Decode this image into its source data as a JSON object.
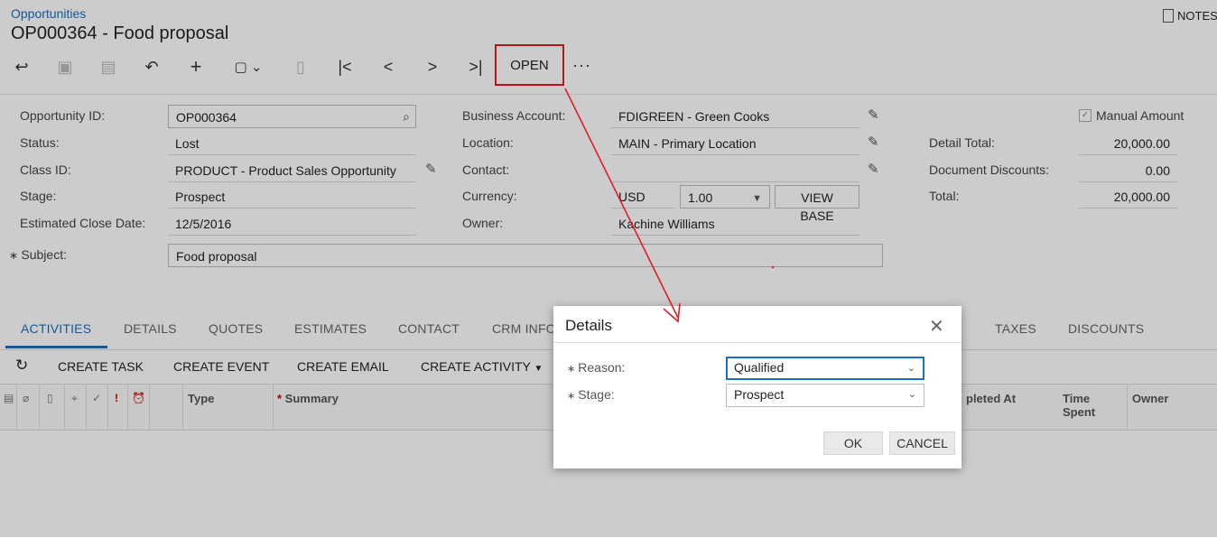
{
  "breadcrumb": "Opportunities",
  "title": "OP000364 - Food proposal",
  "notes_label": "NOTES",
  "toolbar": {
    "open_label": "OPEN",
    "more_label": "···",
    "icons": [
      "back-icon",
      "save-close-icon",
      "save-icon",
      "undo-icon",
      "add-icon",
      "copy-paste-icon",
      "delete-icon",
      "first-record-icon",
      "previous-record-icon",
      "next-record-icon",
      "last-record-icon"
    ]
  },
  "form": {
    "opportunity_id_label": "Opportunity ID:",
    "opportunity_id": "OP000364",
    "status_label": "Status:",
    "status": "Lost",
    "class_id_label": "Class ID:",
    "class_id": "PRODUCT - Product Sales Opportunity",
    "stage_label": "Stage:",
    "stage": "Prospect",
    "close_date_label": "Estimated Close Date:",
    "close_date": "12/5/2016",
    "subject_label": "Subject:",
    "subject": "Food proposal",
    "business_account_label": "Business Account:",
    "business_account": "FDIGREEN - Green Cooks",
    "location_label": "Location:",
    "location": "MAIN - Primary Location",
    "contact_label": "Contact:",
    "contact": "",
    "currency_label": "Currency:",
    "currency": "USD",
    "rate": "1.00",
    "view_base_label": "VIEW BASE",
    "owner_label": "Owner:",
    "owner": "Kachine Williams",
    "manual_amount_label": "Manual Amount",
    "detail_total_label": "Detail Total:",
    "detail_total": "20,000.00",
    "doc_discounts_label": "Document Discounts:",
    "doc_discounts": "0.00",
    "total_label": "Total:",
    "total": "20,000.00"
  },
  "tabs": [
    "ACTIVITIES",
    "DETAILS",
    "QUOTES",
    "ESTIMATES",
    "CONTACT",
    "CRM INFO",
    "TAXES",
    "DISCOUNTS"
  ],
  "activity_toolbar": {
    "create_task": "CREATE TASK",
    "create_event": "CREATE EVENT",
    "create_email": "CREATE EMAIL",
    "create_activity": "CREATE ACTIVITY"
  },
  "grid": {
    "type": "Type",
    "summary": "Summary",
    "completed_at": "pleted At",
    "time_spent_1": "Time",
    "time_spent_2": "Spent",
    "owner": "Owner"
  },
  "dialog": {
    "title": "Details",
    "reason_label": "Reason:",
    "reason": "Qualified",
    "stage_label": "Stage:",
    "stage": "Prospect",
    "ok_label": "OK",
    "cancel_label": "CANCEL"
  },
  "colors": {
    "accent": "#1a6fc0",
    "highlight": "#e31d27"
  }
}
